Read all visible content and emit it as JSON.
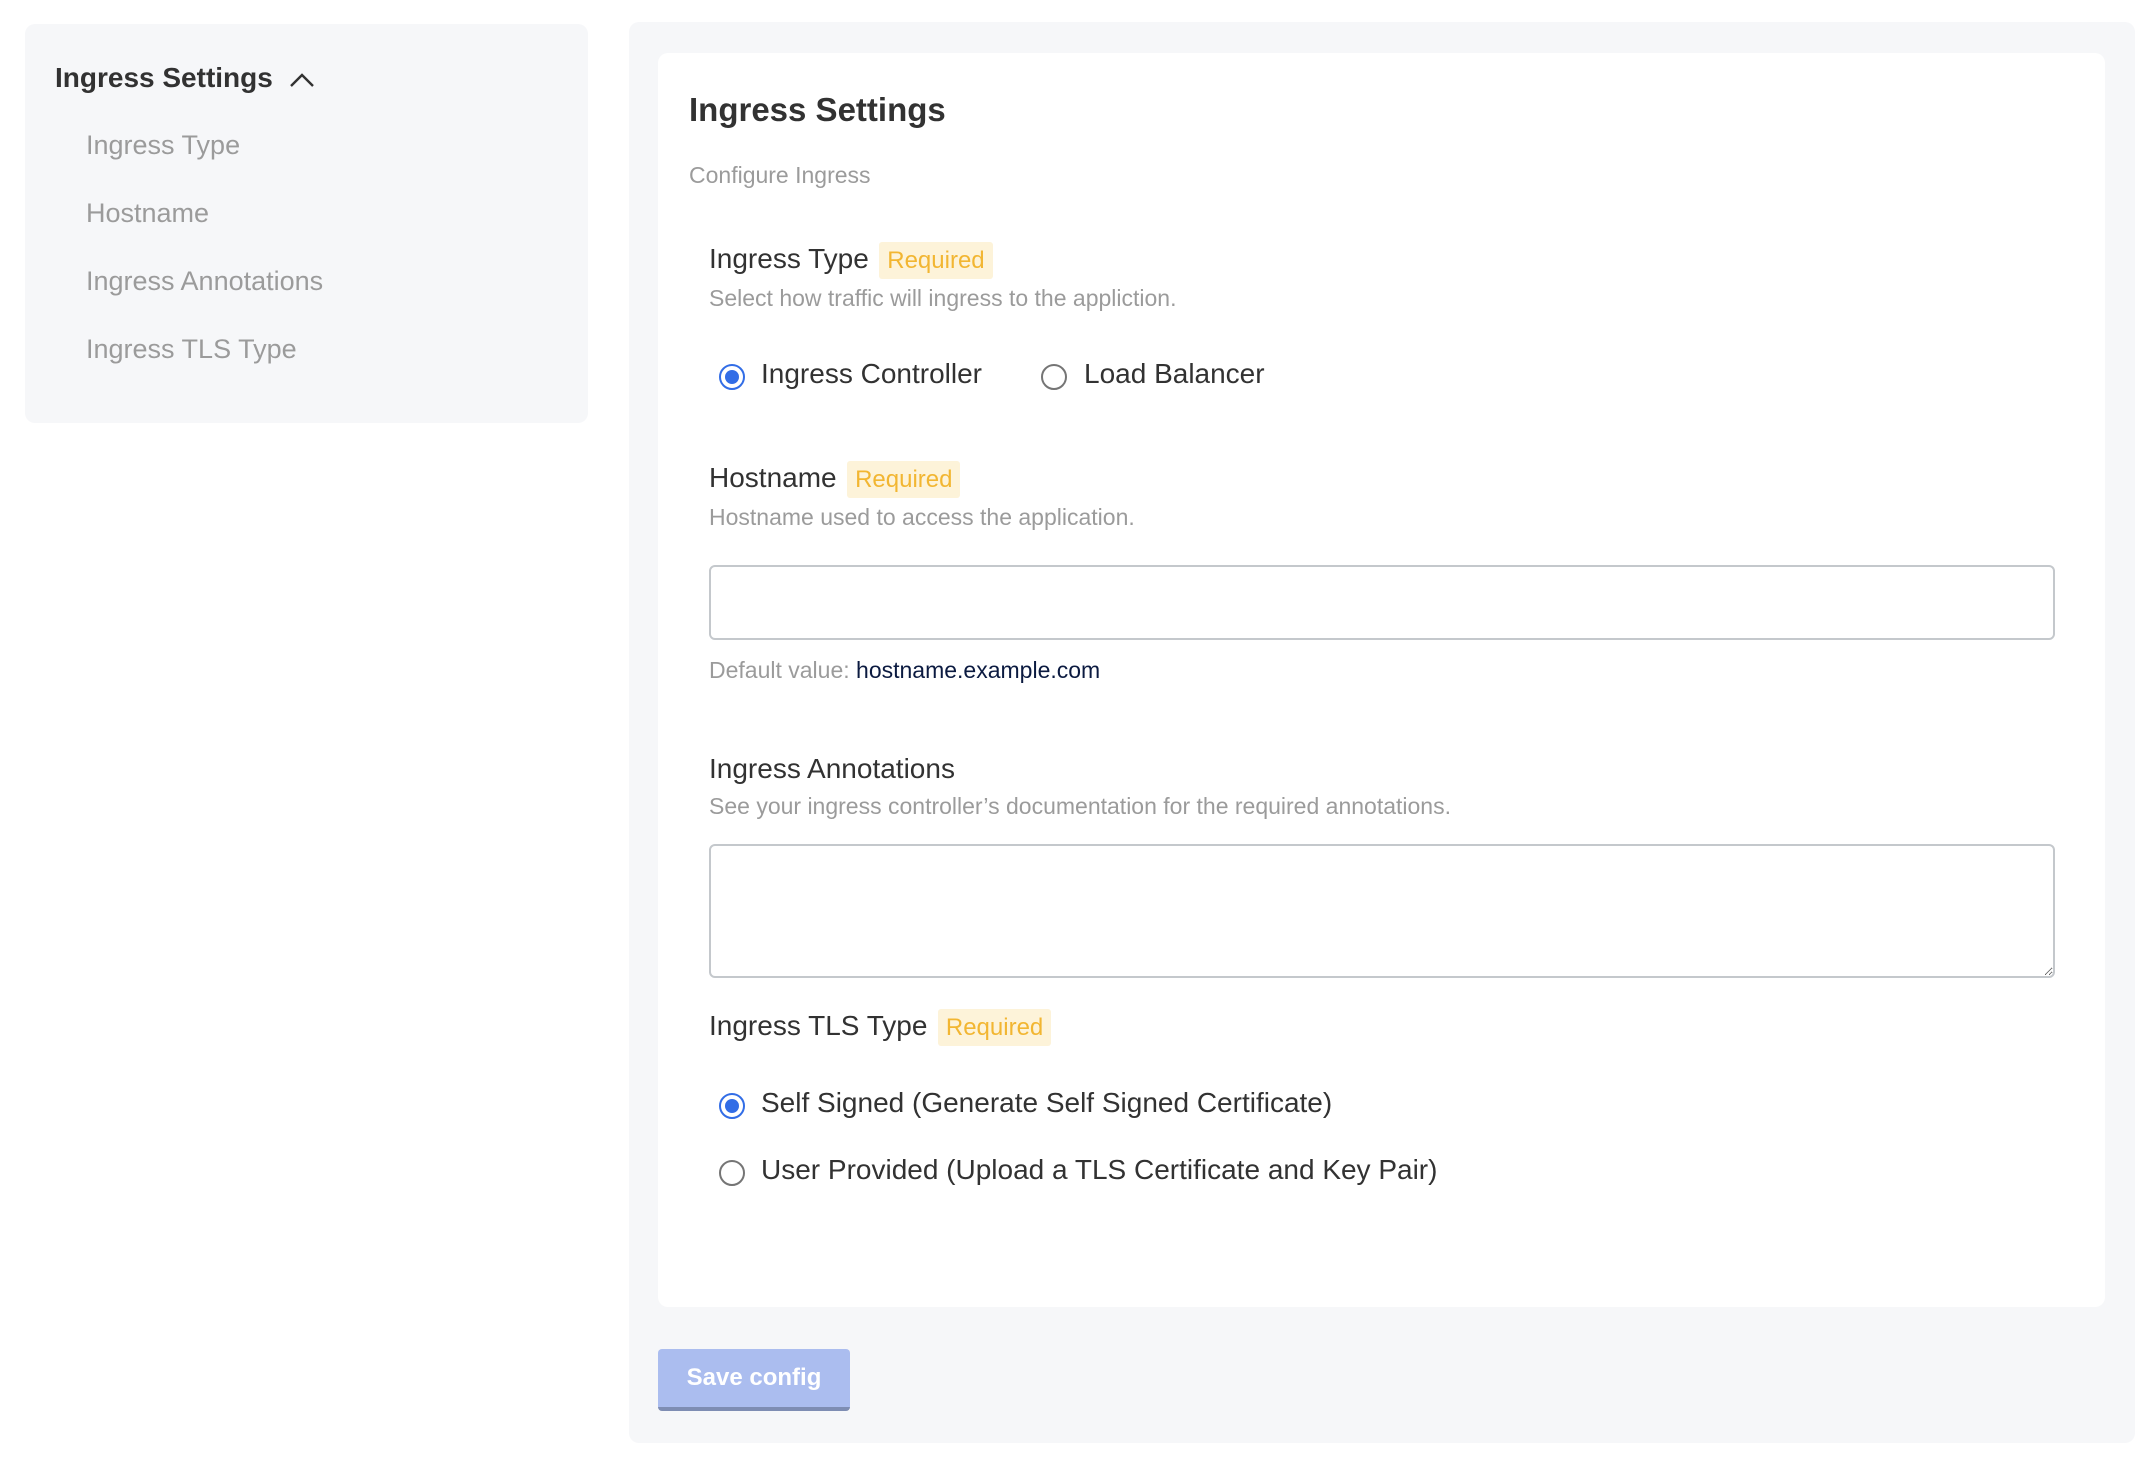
{
  "sidebar": {
    "header": "Ingress Settings",
    "header_icon": "chevron-up-icon",
    "items": [
      {
        "label": "Ingress Type"
      },
      {
        "label": "Hostname"
      },
      {
        "label": "Ingress Annotations"
      },
      {
        "label": "Ingress TLS Type"
      }
    ]
  },
  "card": {
    "title": "Ingress Settings",
    "subtitle": "Configure Ingress",
    "ingress_type": {
      "label": "Ingress Type",
      "badge": "Required",
      "description": "Select how traffic will ingress to the appliction.",
      "options": [
        {
          "label": "Ingress Controller",
          "selected": true
        },
        {
          "label": "Load Balancer",
          "selected": false
        }
      ]
    },
    "hostname": {
      "label": "Hostname",
      "badge": "Required",
      "description": "Hostname used to access the application.",
      "value": "",
      "default_prefix": "Default value:",
      "default_value": "hostname.example.com"
    },
    "annotations": {
      "label": "Ingress Annotations",
      "description": "See your ingress controller’s documentation for the required annotations.",
      "value": ""
    },
    "tls_type": {
      "label": "Ingress TLS Type",
      "badge": "Required",
      "options": [
        {
          "label": "Self Signed (Generate Self Signed Certificate)",
          "selected": true
        },
        {
          "label": "User Provided (Upload a TLS Certificate and Key Pair)",
          "selected": false
        }
      ]
    }
  },
  "save_button": {
    "label": "Save config",
    "disabled": true
  },
  "colors": {
    "accent": "#326de6",
    "badge_text": "#f2b632",
    "badge_bg": "#fdf3d9",
    "button_disabled": "#abbdef"
  }
}
